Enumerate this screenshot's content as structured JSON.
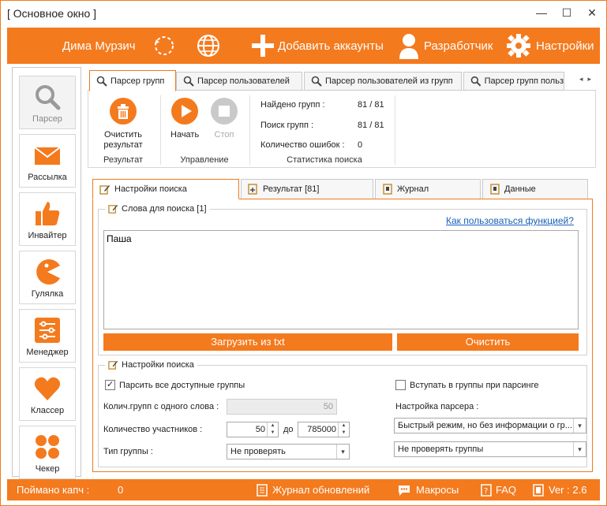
{
  "window": {
    "title": "[ Основное окно ]",
    "minimize": "—",
    "maximize": "☐",
    "close": "✕"
  },
  "topbar": {
    "user": "Дима Мурзич",
    "add_accounts": "Добавить аккаунты",
    "developer": "Разработчик",
    "settings": "Настройки"
  },
  "sidebar": {
    "items": [
      {
        "label": "Парсер"
      },
      {
        "label": "Рассылка"
      },
      {
        "label": "Инвайтер"
      },
      {
        "label": "Гулялка"
      },
      {
        "label": "Менеджер"
      },
      {
        "label": "Классер"
      },
      {
        "label": "Чекер"
      }
    ]
  },
  "tabs": [
    {
      "label": "Парсер групп"
    },
    {
      "label": "Парсер пользователей"
    },
    {
      "label": "Парсер пользователей из групп"
    },
    {
      "label": "Парсер групп польз"
    }
  ],
  "ribbon": {
    "clear_label_1": "Очистить",
    "clear_label_2": "результат",
    "group_result": "Результат",
    "start": "Начать",
    "stop": "Стоп",
    "group_control": "Управление",
    "stats": {
      "found_label": "Найдено групп :",
      "found_value": "81 / 81",
      "search_label": "Поиск групп :",
      "search_value": "81 / 81",
      "errors_label": "Количество ошибок :",
      "errors_value": "0"
    },
    "group_stats": "Статистика поиска"
  },
  "inner_tabs": [
    {
      "label": "Настройки поиска"
    },
    {
      "label": "Результат [81]"
    },
    {
      "label": "Журнал"
    },
    {
      "label": "Данные"
    }
  ],
  "words": {
    "legend": "Слова для поиска [1]",
    "help_link": "Как пользоваться функцией?",
    "text": "Паша",
    "load_btn": "Загрузить из txt",
    "clear_btn": "Очистить"
  },
  "settings": {
    "legend": "Настройки поиска",
    "parse_all": "Парсить все доступные группы",
    "join": "Вступать в группы при парсинге",
    "groups_per_word_label": "Колич.групп с одного слова :",
    "groups_per_word_value": "50",
    "members_label": "Количество участников :",
    "members_from": "50",
    "members_to_label": "до",
    "members_to": "785000",
    "group_type_label": "Тип группы :",
    "group_type_value": "Не проверять",
    "parser_setting_label": "Настройка парсера :",
    "parser_mode_value": "Быстрый режим, но без информации о гр...",
    "check_groups_value": "Не проверять группы"
  },
  "status": {
    "captcha_label": "Поймано капч :",
    "captcha_value": "0",
    "updates": "Журнал обновлений",
    "macros": "Макросы",
    "faq": "FAQ",
    "version": "Ver : 2.6"
  },
  "colors": {
    "accent": "#f47a1e"
  }
}
